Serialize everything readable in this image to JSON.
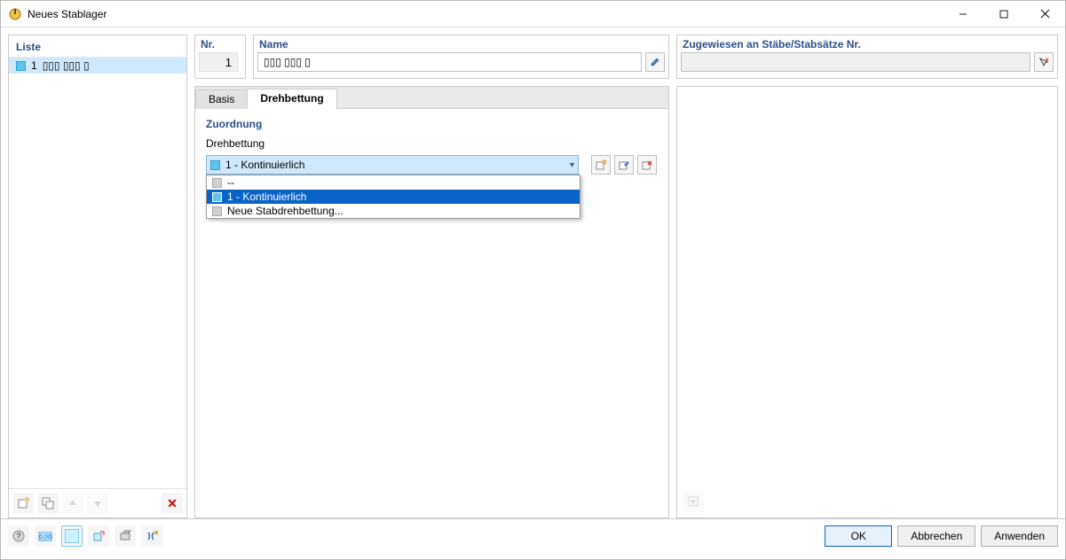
{
  "window": {
    "title": "Neues Stablager"
  },
  "left": {
    "header": "Liste",
    "items": [
      {
        "num": "1",
        "text": "▯▯▯ ▯▯▯ ▯"
      }
    ]
  },
  "fields": {
    "nr": {
      "label": "Nr.",
      "value": "1"
    },
    "name": {
      "label": "Name",
      "value": "▯▯▯ ▯▯▯ ▯"
    },
    "assign": {
      "label": "Zugewiesen an Stäbe/Stabsätze Nr.",
      "value": ""
    }
  },
  "tabs": {
    "basis": "Basis",
    "dreh": "Drehbettung",
    "active": "dreh"
  },
  "main": {
    "section": "Zuordnung",
    "label": "Drehbettung",
    "combo_value": "1 - Kontinuierlich",
    "options": [
      {
        "label": "--"
      },
      {
        "label": "1 - Kontinuierlich",
        "selected": true
      },
      {
        "label": "Neue Stabdrehbettung..."
      }
    ]
  },
  "buttons": {
    "ok": "OK",
    "cancel": "Abbrechen",
    "apply": "Anwenden"
  }
}
